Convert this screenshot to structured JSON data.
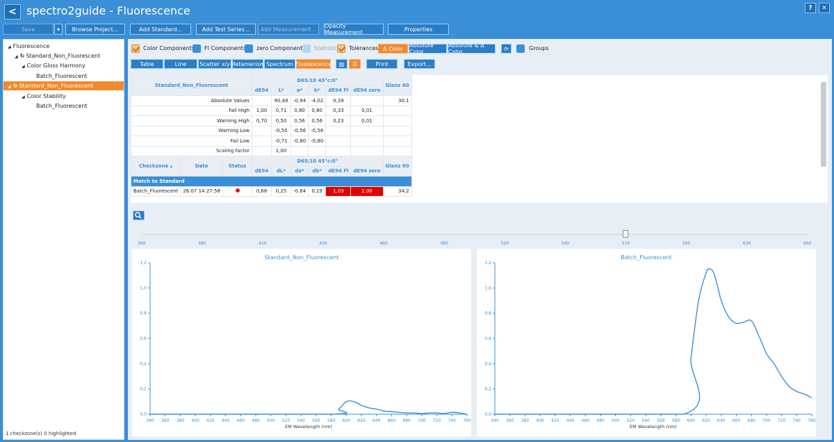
{
  "app": {
    "title": "spectro2guide - Fluorescence",
    "back_icon": "chevron-left-icon",
    "help": "?",
    "close": "✕"
  },
  "toolbar": [
    "Save",
    "Browse Project...",
    "Add Standard...",
    "Add Test Series...",
    "Add Measurement...",
    "Opacity Measurement",
    "Properties"
  ],
  "tree": [
    {
      "label": "Fluorescence",
      "level": 0
    },
    {
      "label": "Standard_Non_Fluorescent",
      "level": 1
    },
    {
      "label": "Color Gloss Harmony",
      "level": 2
    },
    {
      "label": "Batch_Fluorescent",
      "level": 3
    },
    {
      "label": "Standard_Non_Fluorescent",
      "level": 1,
      "selected": true
    },
    {
      "label": "Color Stability",
      "level": 2
    },
    {
      "label": "Batch_Fluorescent",
      "level": 3
    }
  ],
  "status": "1 checkzone(s) 0 highlighted",
  "options": {
    "color_components": "Color Components",
    "fl_components": "Fl Components",
    "zero_components": "zero Components",
    "statistic": "Statistic",
    "tolerances": "Tolerances",
    "delta_color": "Δ Color",
    "absolute_color": "Absolute Color",
    "absolute_delta": "Absolute & Δ Color",
    "groups": "Groups"
  },
  "views": [
    "Table",
    "Line",
    "Scatter x/y",
    "Metamerism",
    "Spectrum",
    "Fluorescence"
  ],
  "actions": {
    "print": "Print",
    "export": "Export..."
  },
  "table": {
    "standard": "Standard_Non_Fluorescent",
    "illuminant": "D65/10  45°c:0°",
    "gloss": "Glanz 60",
    "cols": [
      "dE94",
      "L*",
      "a*",
      "b*",
      "dE94 Fl",
      "dE94 zero"
    ],
    "rows": [
      {
        "label": "Absolute Values",
        "v": [
          "",
          "90,48",
          "-0,94",
          "-4,02",
          "0,39",
          ""
        ],
        "g": "30,1"
      },
      {
        "label": "Fail High",
        "v": [
          "1,00",
          "0,71",
          "0,80",
          "0,80",
          "0,33",
          "0,01"
        ],
        "g": ""
      },
      {
        "label": "Warning High",
        "v": [
          "0,70",
          "0,50",
          "0,56",
          "0,56",
          "0,23",
          "0,01"
        ],
        "g": ""
      },
      {
        "label": "Warning Low",
        "v": [
          "",
          "-0,50",
          "-0,56",
          "-0,56",
          "",
          ""
        ],
        "g": ""
      },
      {
        "label": "Fail Low",
        "v": [
          "",
          "-0,71",
          "-0,80",
          "-0,80",
          "",
          ""
        ],
        "g": ""
      },
      {
        "label": "Scaling factor",
        "v": [
          "",
          "1,00",
          "",
          "",
          "",
          ""
        ],
        "g": ""
      }
    ],
    "hdr2": {
      "checkzone": "Checkzone ▴",
      "date": "Date",
      "status": "Status",
      "cols": [
        "dE94",
        "dL*",
        "da*",
        "db*",
        "dE94 Fl",
        "dE94 zero"
      ]
    },
    "band": "Match to Standard",
    "sample": {
      "name": "Batch_Fluorescent",
      "date": "26.07 14:27:58",
      "v": [
        "0,68",
        "0,25",
        "-0,64",
        "0,19",
        "1,03",
        "2,00"
      ],
      "g": "34,2"
    }
  },
  "scale": [
    "360",
    "380",
    "410",
    "430",
    "460",
    "490",
    "520",
    "540",
    "570",
    "595",
    "630",
    "660"
  ],
  "chart_data": [
    {
      "type": "line",
      "title": "Standard_Non_Fluorescent",
      "xlabel": "EM Wavelength (nm)",
      "ylabel": "",
      "xlim": [
        340,
        760
      ],
      "ylim": [
        0,
        1.2
      ],
      "xticks": [
        340,
        360,
        380,
        400,
        420,
        440,
        460,
        480,
        500,
        520,
        540,
        560,
        580,
        600,
        620,
        640,
        660,
        680,
        700,
        720,
        740,
        760
      ],
      "yticks": [
        0,
        0.2,
        0.4,
        0.6,
        0.8,
        1.0,
        1.2
      ],
      "ytick_labels": [
        "0,0",
        "0,2",
        "0,4",
        "0,6",
        "0,8",
        "1,0",
        "1,2"
      ],
      "color": "#3a8fd6",
      "x": [
        340,
        580,
        590,
        600,
        610,
        620,
        630,
        640,
        650,
        660,
        670,
        680,
        690,
        700,
        710,
        720,
        730,
        740,
        750,
        760
      ],
      "y": [
        0,
        0,
        0.04,
        0.1,
        0.1,
        0.07,
        0.05,
        0.04,
        0.025,
        0.02,
        0.015,
        0.01,
        0.01,
        0.005,
        0.01,
        0.01,
        0.005,
        0.015,
        0.01,
        0.0
      ]
    },
    {
      "type": "line",
      "title": "Batch_Fluorescent",
      "xlabel": "EM Wavelength (nm)",
      "ylabel": "",
      "xlim": [
        340,
        760
      ],
      "ylim": [
        0,
        1.2
      ],
      "xticks": [
        340,
        360,
        380,
        400,
        420,
        440,
        460,
        480,
        500,
        520,
        540,
        560,
        580,
        600,
        620,
        640,
        660,
        680,
        700,
        720,
        740,
        760
      ],
      "yticks": [
        0,
        0.2,
        0.4,
        0.6,
        0.8,
        1.0,
        1.2
      ],
      "ytick_labels": [
        "0,0",
        "0,2",
        "0,4",
        "0,6",
        "0,8",
        "1,0",
        "1,2"
      ],
      "color": "#3a8fd6",
      "x": [
        340,
        590,
        600,
        610,
        620,
        625,
        630,
        635,
        640,
        650,
        660,
        670,
        680,
        690,
        700,
        710,
        720,
        730,
        740,
        750,
        760
      ],
      "y": [
        0,
        0,
        0.45,
        0.9,
        1.12,
        1.15,
        1.12,
        1.02,
        0.9,
        0.77,
        0.72,
        0.73,
        0.74,
        0.62,
        0.48,
        0.4,
        0.3,
        0.22,
        0.18,
        0.16,
        0.13
      ]
    }
  ]
}
